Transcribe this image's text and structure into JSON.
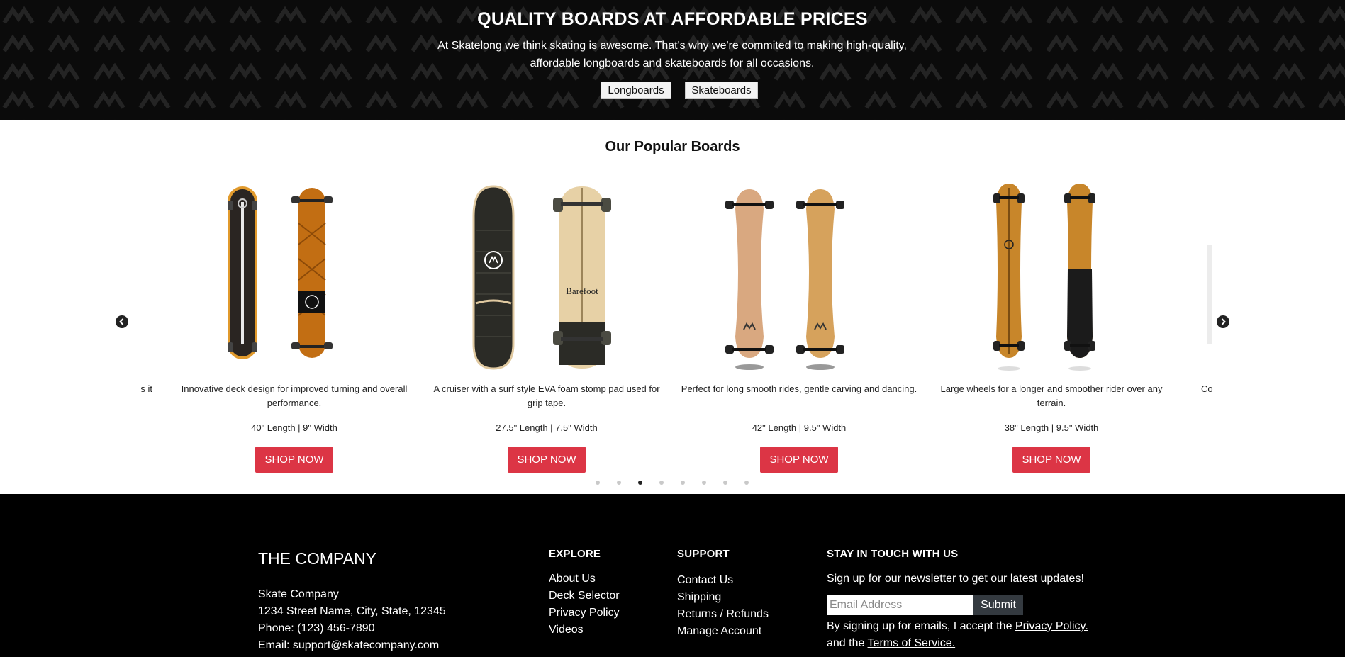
{
  "hero": {
    "title": "QUALITY BOARDS AT AFFORDABLE PRICES",
    "description": "At Skatelong we think skating is awesome. That's why we're commited to making high-quality, affordable longboards and skateboards for all occasions.",
    "buttons": [
      "Longboards",
      "Skateboards"
    ]
  },
  "popular": {
    "title": "Our Popular Boards",
    "peek_left": "s it",
    "peek_right": "Co",
    "cards": [
      {
        "description": "Innovative deck design for improved turning and overall performance.",
        "spec": "40\" Length | 9\" Width",
        "button": "SHOP NOW"
      },
      {
        "description": "A cruiser with a surf style EVA foam stomp pad used for grip tape.",
        "spec": "27.5\" Length | 7.5\" Width",
        "button": "SHOP NOW"
      },
      {
        "description": "Perfect for long smooth rides, gentle carving and dancing.",
        "spec": "42\" Length | 9.5\" Width",
        "button": "SHOP NOW"
      },
      {
        "description": "Large wheels for a longer and smoother rider over any terrain.",
        "spec": "38\" Length | 9.5\" Width",
        "button": "SHOP NOW"
      }
    ],
    "carousel": {
      "total_slides": 8,
      "active_index": 2
    }
  },
  "footer": {
    "company": {
      "title": "THE COMPANY",
      "name": "Skate Company",
      "address": "1234 Street Name, City, State, 12345",
      "phone": "Phone: (123) 456-7890",
      "email": "Email: support@skatecompany.com"
    },
    "explore": {
      "heading": "EXPLORE",
      "links": [
        "About Us",
        "Deck Selector",
        "Privacy Policy",
        "Videos"
      ]
    },
    "support": {
      "heading": "SUPPORT",
      "links": [
        "Contact Us",
        "Shipping",
        "Returns / Refunds",
        "Manage Account"
      ]
    },
    "newsletter": {
      "heading": "STAY IN TOUCH WITH US",
      "text": "Sign up for our newsletter to get our latest updates!",
      "placeholder": "Email Address",
      "submit": "Submit",
      "legal_prefix": "By signing up for emails, I accept the",
      "privacy_link": "Privacy Policy.",
      "legal_mid": "and the",
      "terms_link": "Terms of Service."
    }
  },
  "colors": {
    "accent": "#dc3545",
    "hero_bg": "#0b0b0b",
    "footer_bg": "#000000",
    "submit_bg": "#343a40"
  }
}
